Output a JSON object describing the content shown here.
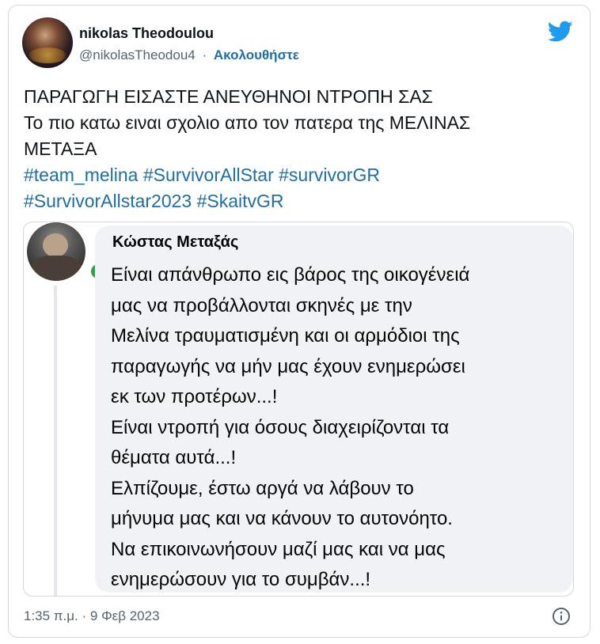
{
  "author": {
    "display_name": "nikolas Theodoulou",
    "handle": "@nikolasTheodou4",
    "separator": "·",
    "follow_label": "Ακολουθήστε",
    "avatar_icon": "profile-photo",
    "logo_icon": "twitter-bird-icon"
  },
  "tweet": {
    "lines": [
      "ΠΑΡΑΓΩΓΗ ΕΙΣΑΣΤΕ ΑΝΕΥΘΗΝΟΙ ΝΤΡΟΠΗ ΣΑΣ",
      "Το πιο κατω ειναι σχολιο απο τον πατερα της ΜΕΛΙΝΑΣ",
      "ΜΕΤΑΞΑ"
    ],
    "hashtags": [
      "#team_melina",
      "#SurvivorAllStar",
      "#survivorGR",
      "#SurvivorAllstar2023",
      "#SkaitvGR"
    ]
  },
  "quoted_comment": {
    "name": "Κώστας Μεταξάς",
    "lines": [
      "Είναι απάνθρωπο εις βάρος της οικογένειά",
      "μας να προβάλλονται σκηνές με την",
      "Μελίνα τραυματισμένη και οι αρμόδιοι της",
      "παραγωγής να μήν μας έχουν ενημερώσει",
      "εκ των προτέρων...!",
      "Είναι ντροπή για όσους διαχειρίζονται τα",
      "θέματα αυτά...!",
      "Ελπίζουμε, έστω αργά να λάβουν το",
      "μήνυμα μας και να κάνουν το αυτονόητο.",
      "Να επικοινωνήσουν μαζί μας και να μας",
      "ενημερώσουν για το συμβάν...!"
    ],
    "online_color": "#31a24c"
  },
  "footer": {
    "timestamp": "1:35 π.μ. · 9 Φεβ 2023",
    "info_icon": "info-icon"
  },
  "colors": {
    "link": "#1d6fa5",
    "twitter_blue": "#1d9bf0",
    "muted": "#536471",
    "border": "#cfd9de",
    "bubble": "#f0f2f5"
  }
}
